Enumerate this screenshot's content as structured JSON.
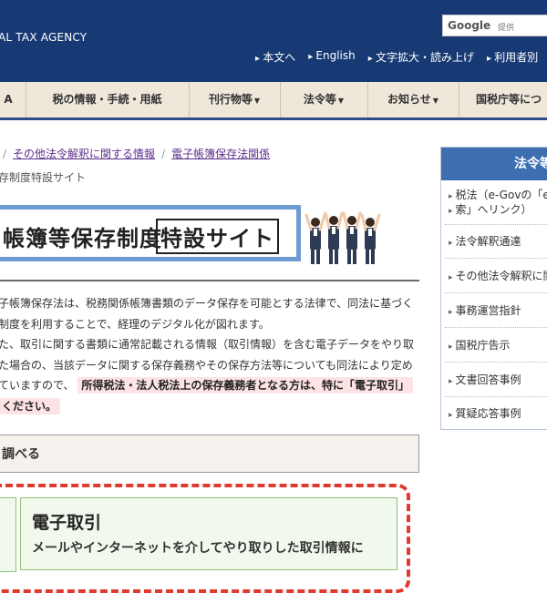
{
  "header": {
    "agency": "AL TAX AGENCY",
    "search_logo": "Google",
    "search_placeholder": "提供",
    "top_links": [
      "本文へ",
      "English",
      "文字拡大・読み上げ",
      "利用者別"
    ]
  },
  "nav": {
    "items": [
      "A",
      "税の情報・手続・用紙",
      "刊行物等",
      "法令等",
      "お知らせ",
      "国税庁等につ"
    ]
  },
  "breadcrumb": {
    "items": [
      "その他法令解釈に関する情報",
      "電子帳簿保存法関係"
    ]
  },
  "subtitle": "存制度特設サイト",
  "banner": {
    "title": "帳簿等保存制度",
    "highlight": "特設サイト"
  },
  "intro": {
    "lines": [
      "子帳簿保存法は、税務関係帳簿書類のデータ保存を可能とする法律で、同法に基づく",
      "制度を利用することで、経理のデジタル化が図れます。",
      "た、取引に関する書類に通常記載される情報（取引情報）を含む電子データをやり取",
      "た場合の、当該データに関する保存義務やその保存方法等についても同法により定め"
    ],
    "line5_prefix": "ていますので、",
    "line5_highlight": "所得税法・法人税法上の保存義務者となる方は、特に「電子取引」",
    "line6_highlight": "ください。"
  },
  "section": {
    "title": "調べる"
  },
  "card": {
    "title": "電子取引",
    "desc": "メールやインターネットを介してやり取りした取引情報に"
  },
  "sidebar": {
    "title": "法令等",
    "items": [
      "税法（e-Govの「e",
      "索」へリンク）",
      "法令解釈通達",
      "その他法令解釈に関",
      "事務運営指針",
      "国税庁告示",
      "文書回答事例",
      "質疑応答事例"
    ]
  },
  "colors": {
    "header_bg": "#183a74",
    "nav_bg": "#efe7da",
    "accent_blue": "#3d6fb0",
    "link_purple": "#5b2f8c",
    "dashed_red": "#e03a2f",
    "card_green_bg": "#f1f8ec"
  }
}
